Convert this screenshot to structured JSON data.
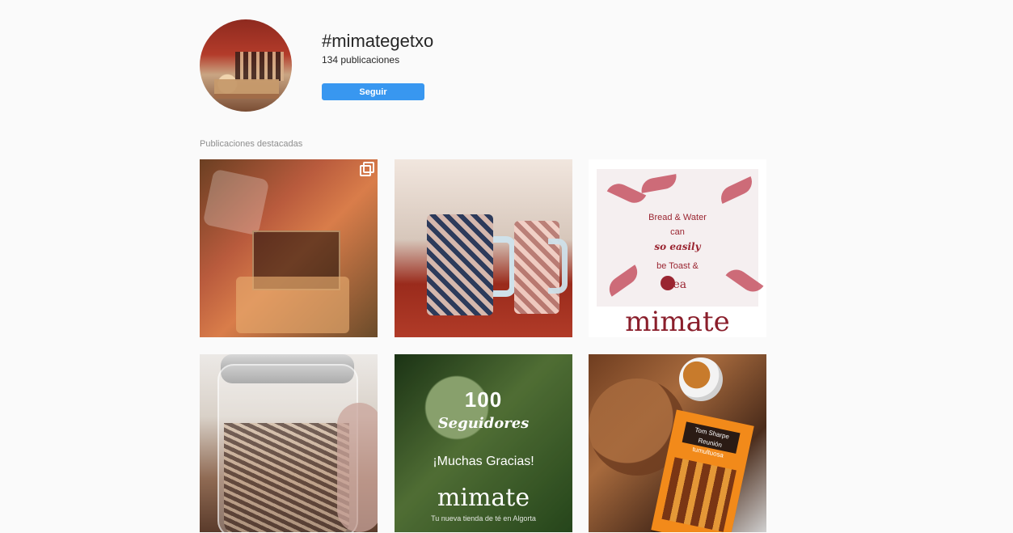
{
  "header": {
    "hashtag": "#mimategetxo",
    "count": "134 publicaciones",
    "follow_label": "Seguir"
  },
  "section": {
    "title": "Publicaciones destacadas"
  },
  "posts": [
    {
      "type": "photo",
      "has_multi_icon": true
    },
    {
      "type": "photo"
    },
    {
      "type": "graphic",
      "lines": [
        "Bread & Water",
        "can",
        "so easily",
        "be Toast &",
        "tea"
      ],
      "brand": "mimate"
    },
    {
      "type": "photo"
    },
    {
      "type": "graphic",
      "number": "100",
      "subtitle": "Seguidores",
      "thanks": "¡Muchas Gracias!",
      "brand": "mimate",
      "tagline": "Tu nueva tienda de té en Algorta"
    },
    {
      "type": "photo",
      "book_label": [
        "Tom Sharpe",
        "Reunión tumultuosa"
      ]
    }
  ],
  "colors": {
    "background": "#fafafa",
    "button_blue": "#3897f0",
    "muted_text": "#8e8e8e"
  },
  "icons": {
    "multi_post": "multiple-posts-icon"
  }
}
